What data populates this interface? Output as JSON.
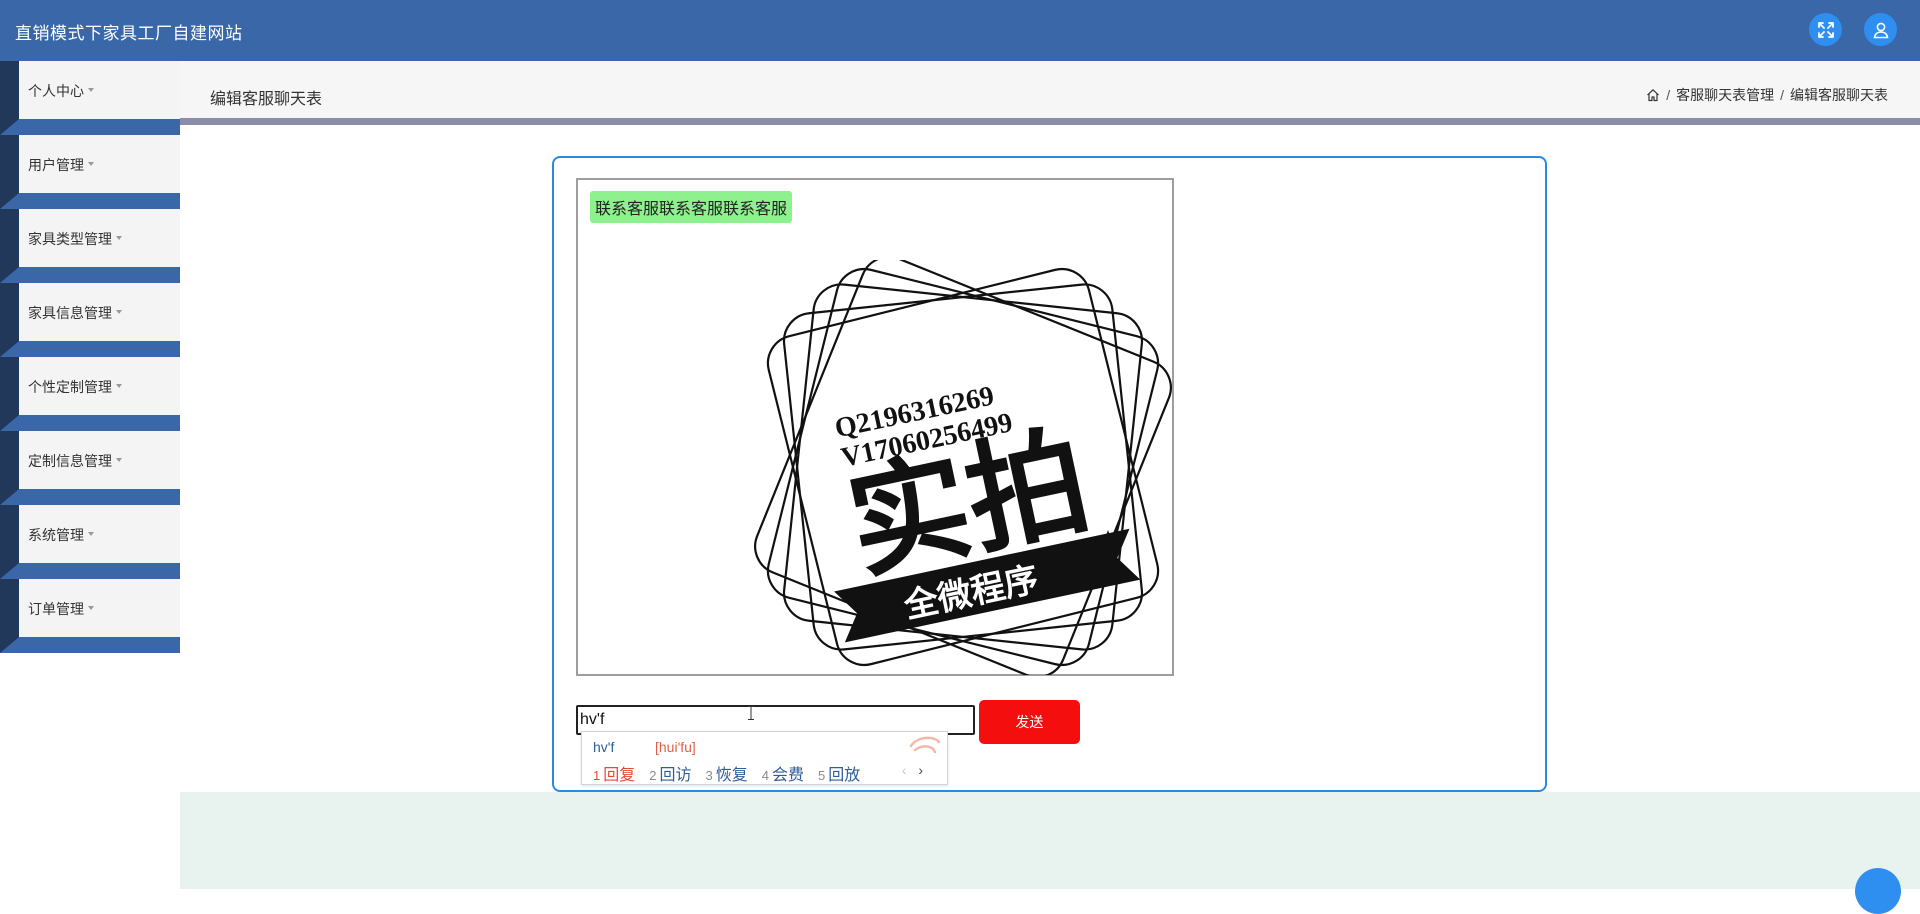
{
  "header": {
    "title": "直销模式下家具工厂自建网站",
    "icons": [
      "fullscreen-icon",
      "user-icon"
    ],
    "accent": "#3a67a8"
  },
  "sidebar": {
    "items": [
      {
        "label": "个人中心"
      },
      {
        "label": "用户管理"
      },
      {
        "label": "家具类型管理"
      },
      {
        "label": "家具信息管理"
      },
      {
        "label": "个性定制管理"
      },
      {
        "label": "定制信息管理"
      },
      {
        "label": "系统管理"
      },
      {
        "label": "订单管理"
      }
    ]
  },
  "breadcrumb": {
    "page_title": "编辑客服聊天表",
    "home_icon": "home-icon",
    "items": [
      "客服聊天表管理",
      "编辑客服聊天表"
    ],
    "separator": "/"
  },
  "chat": {
    "messages": [
      {
        "text": "联系客服联系客服联系客服",
        "bubble_color": "#8df28d"
      }
    ],
    "image": {
      "line1": "Q2196316269",
      "line2": "V17060256499",
      "big_text": "实拍",
      "banner_text": "全微程序"
    },
    "input": {
      "value": "hv'f"
    },
    "send_label": "发送",
    "send_color": "#f50e0e"
  },
  "ime": {
    "composition": "hv'f",
    "pinyin": "[hui'fu]",
    "candidates": [
      {
        "num": "1",
        "word": "回复"
      },
      {
        "num": "2",
        "word": "回访"
      },
      {
        "num": "3",
        "word": "恢复"
      },
      {
        "num": "4",
        "word": "会费"
      },
      {
        "num": "5",
        "word": "回放"
      }
    ],
    "prev": "‹",
    "next": "›"
  }
}
